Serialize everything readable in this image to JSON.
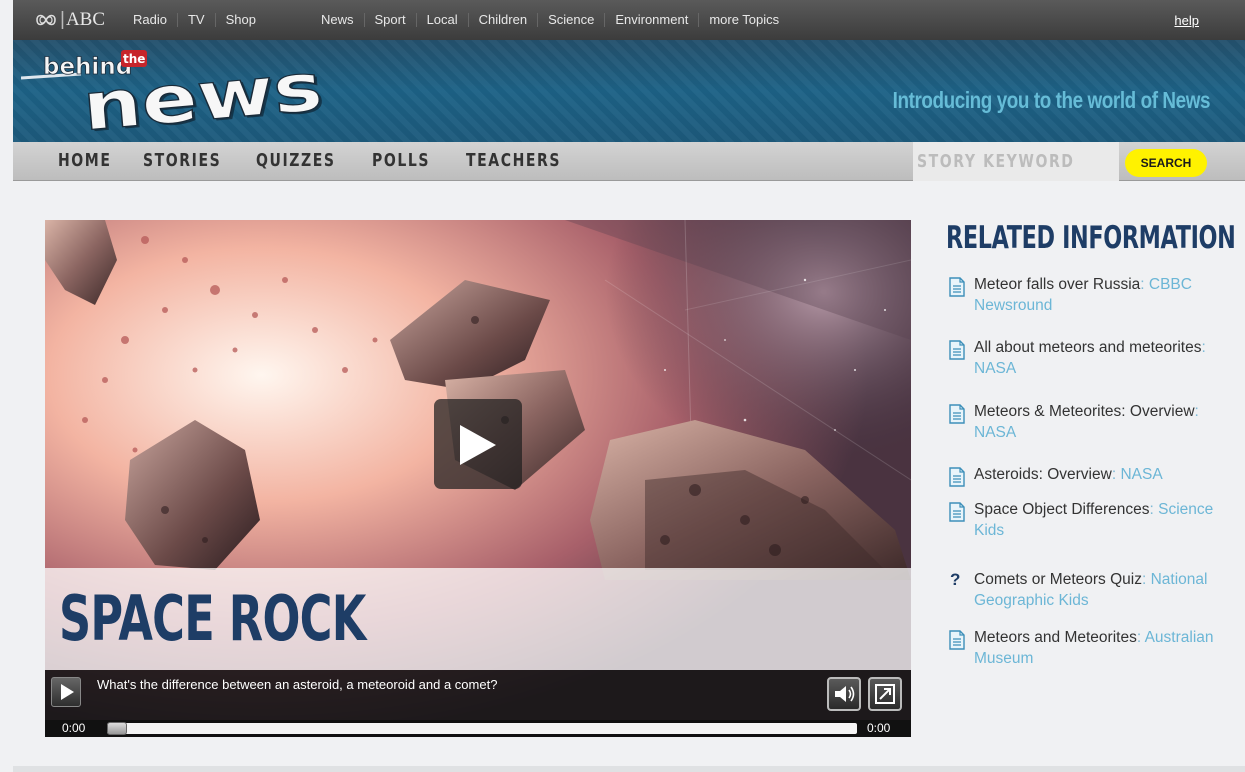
{
  "abc_bar": {
    "logo_text": "ABC",
    "primary_links": [
      "Radio",
      "TV",
      "Shop"
    ],
    "topic_links": [
      "News",
      "Sport",
      "Local",
      "Children",
      "Science",
      "Environment",
      "more Topics"
    ],
    "help": "help"
  },
  "masthead": {
    "logo_small": "behind",
    "logo_the": "the",
    "logo_big": "news",
    "tagline": "Introducing you to the world of News"
  },
  "nav": {
    "items": [
      "HOME",
      "STORIES",
      "QUIZZES",
      "POLLS",
      "TEACHERS"
    ],
    "search_placeholder": "STORY KEYWORD",
    "search_button": "SEARCH"
  },
  "video": {
    "title": "SPACE ROCK",
    "caption": "What's the difference between an asteroid, a meteoroid and a comet?",
    "time_current": "0:00",
    "time_total": "0:00",
    "progress": 0
  },
  "related": {
    "heading": "RELATED INFORMATION",
    "items": [
      {
        "icon": "document-icon",
        "title": "Meteor falls over Russia",
        "source": "CBBC Newsround"
      },
      {
        "icon": "document-icon",
        "title": "All about meteors and meteorites",
        "source": "NASA"
      },
      {
        "icon": "document-icon",
        "title": "Meteors & Meteorites: Overview",
        "source": "NASA"
      },
      {
        "icon": "document-icon",
        "title": "Asteroids: Overview",
        "source": "NASA"
      },
      {
        "icon": "document-icon",
        "title": "Space Object Differences",
        "source": "Science Kids"
      },
      {
        "icon": "question-icon",
        "title": "Comets or Meteors Quiz",
        "source": "National Geographic Kids",
        "glyph": "?"
      },
      {
        "icon": "document-icon",
        "title": "Meteors and Meteorites",
        "source": "Australian Museum"
      }
    ]
  },
  "colors": {
    "brand_navy": "#1e3d66",
    "tagline": "#66bcd7",
    "search_button": "#fff200",
    "link_source": "#6cb6d6"
  }
}
